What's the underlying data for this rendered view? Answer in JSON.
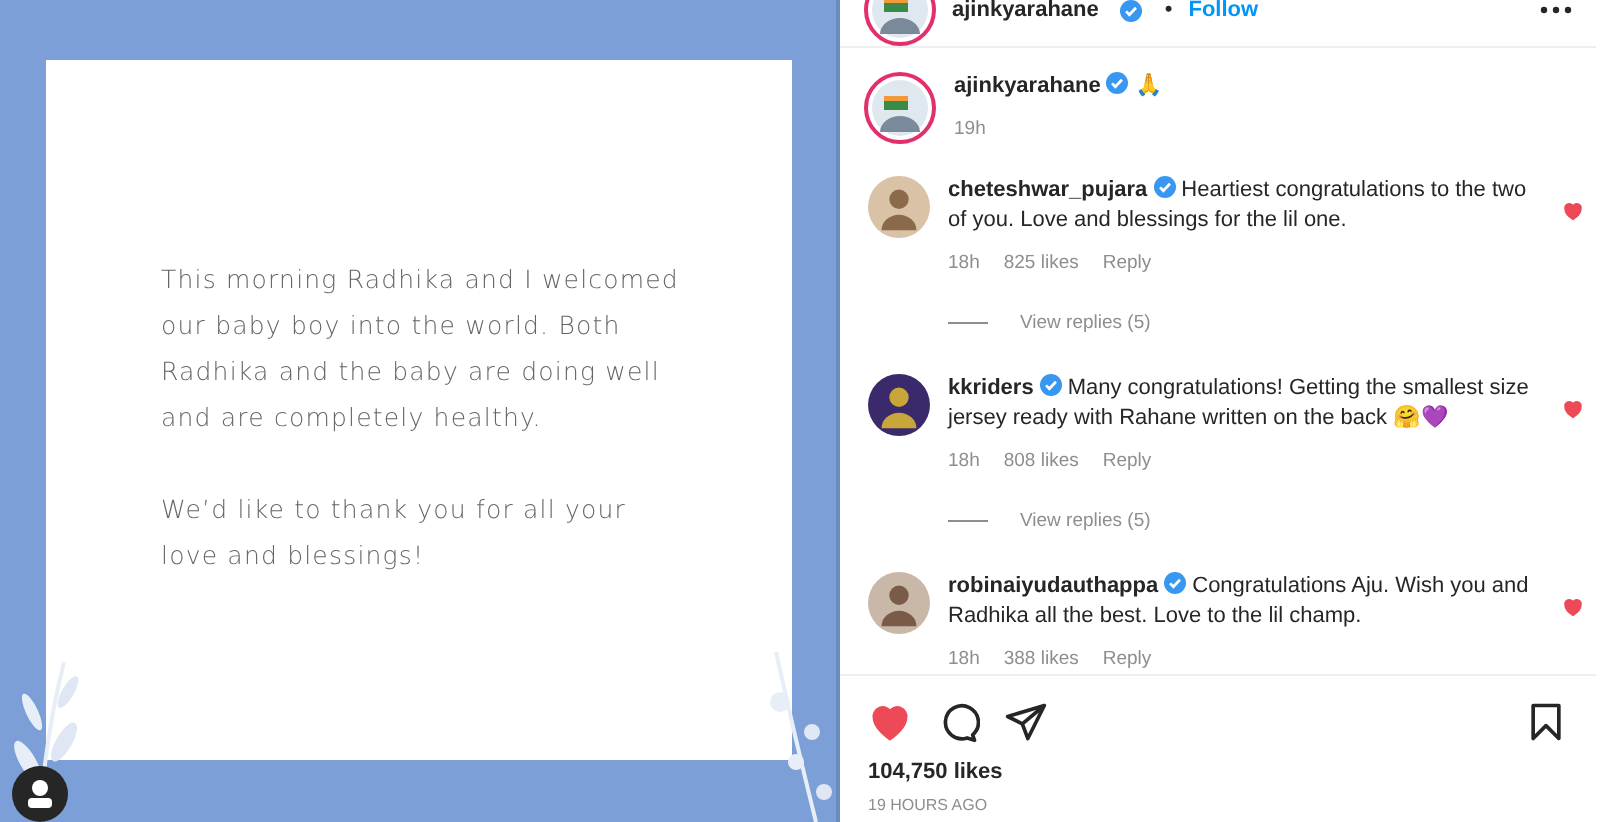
{
  "post": {
    "paragraphs": [
      "This morning Radhika and I welcomed our baby boy into the world. Both Radhika and the baby are doing well and are completely healthy.",
      "We’d like to thank you for all your love and blessings!"
    ]
  },
  "header": {
    "username": "ajinkyarahane",
    "verified": true,
    "separator": "•",
    "follow": "Follow"
  },
  "caption": {
    "username": "ajinkyarahane",
    "verified": true,
    "text": "🙏",
    "time": "19h"
  },
  "comments": [
    {
      "username": "cheteshwar_pujara",
      "verified": true,
      "text": "Heartiest congratulations to the two of you. Love and blessings for the lil one.",
      "time": "18h",
      "likes": "825 likes",
      "reply": "Reply",
      "liked": true,
      "view_replies": "View replies (5)"
    },
    {
      "username": "kkriders",
      "verified": true,
      "text": "Many congratulations! Getting the smallest size jersey ready with Rahane written on the back 🤗💜",
      "time": "18h",
      "likes": "808 likes",
      "reply": "Reply",
      "liked": true,
      "view_replies": "View replies (5)"
    },
    {
      "username": "robinaiyudauthappa",
      "verified": true,
      "text": "Congratulations Aju. Wish you and Radhika all the best. Love to the lil champ.",
      "time": "18h",
      "likes": "388 likes",
      "reply": "Reply",
      "liked": true
    }
  ],
  "actions": {
    "liked": true,
    "likes": "104,750 likes",
    "time": "19 HOURS AGO"
  }
}
